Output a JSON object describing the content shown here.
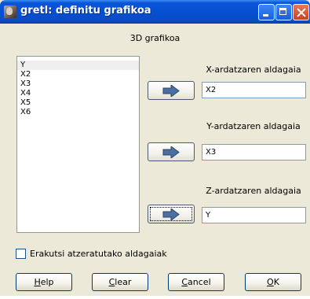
{
  "window": {
    "title": "gretl: definitu grafikoa"
  },
  "dialog": {
    "subtitle": "3D grafikoa",
    "variables": [
      "Y",
      "X2",
      "X3",
      "X4",
      "X5",
      "X6"
    ],
    "x_axis": {
      "label": "X-ardatzaren aldagaia",
      "value": "X2"
    },
    "y_axis": {
      "label": "Y-ardatzaren aldagaia",
      "value": "X3"
    },
    "z_axis": {
      "label": "Z-ardatzaren aldagaia",
      "value": "Y"
    },
    "show_omitted_label": "Erakutsi atzeratutako aldagaiak",
    "show_omitted_checked": false
  },
  "buttons": {
    "help": {
      "mnemonic": "H",
      "rest": "elp"
    },
    "clear": {
      "mnemonic": "C",
      "rest": "lear"
    },
    "cancel": {
      "mnemonic": "C",
      "rest": "ancel"
    },
    "ok": {
      "mnemonic": "O",
      "rest": "K"
    }
  },
  "icons": {
    "arrow": "right-arrow-icon",
    "app": "gretl-app-icon"
  },
  "colors": {
    "titlebar": "#0550d0",
    "dialog_bg": "#ece9d8",
    "arrow_fill": "#4a6fa0"
  }
}
